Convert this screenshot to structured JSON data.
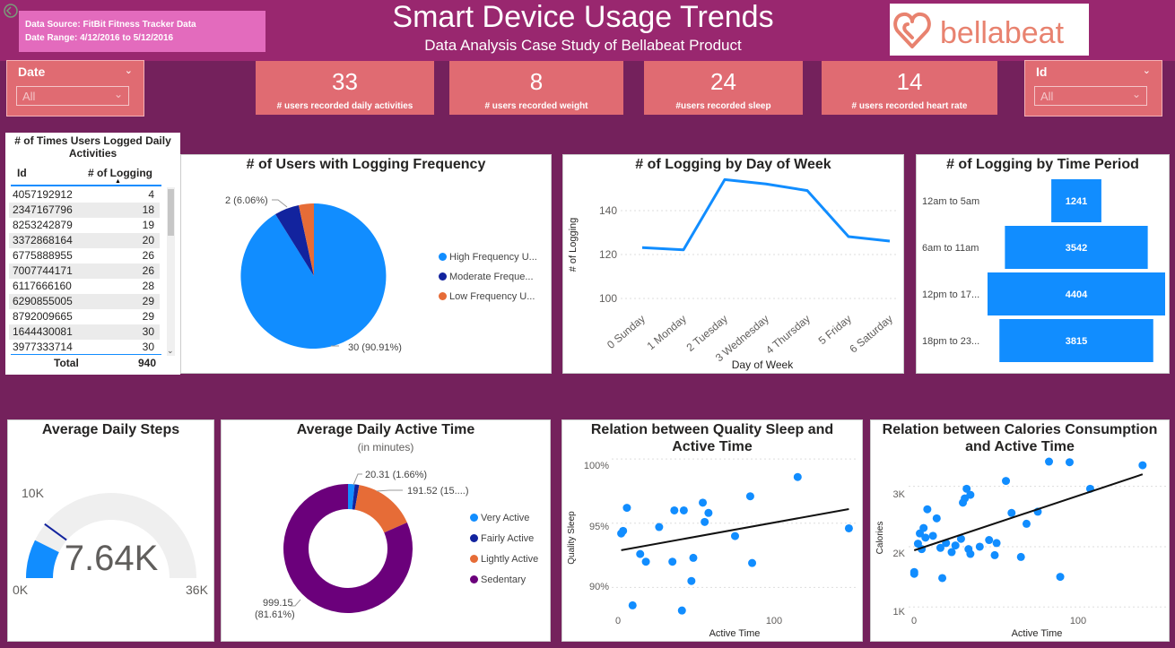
{
  "header": {
    "title": "Smart Device Usage Trends",
    "subtitle": "Data Analysis Case Study of Bellabeat Product",
    "source_line": "Data Source: FitBit Fitness Tracker Data",
    "range_line": "Date Range: 4/12/2016 to 5/12/2016",
    "logo_text": "bellabeat"
  },
  "slicers": {
    "date": {
      "label": "Date",
      "value": "All"
    },
    "id": {
      "label": "Id",
      "value": "All"
    }
  },
  "cards": [
    {
      "value": "33",
      "caption": "# users recorded daily activities"
    },
    {
      "value": "8",
      "caption": "# users recorded weight"
    },
    {
      "value": "24",
      "caption": "#users recorded sleep"
    },
    {
      "value": "14",
      "caption": "# users recorded heart rate"
    }
  ],
  "log_table": {
    "title": "# of Times Users Logged Daily Activities",
    "col_id": "Id",
    "col_count": "# of Logging",
    "rows": [
      {
        "id": "4057192912",
        "n": "4"
      },
      {
        "id": "2347167796",
        "n": "18"
      },
      {
        "id": "8253242879",
        "n": "19"
      },
      {
        "id": "3372868164",
        "n": "20"
      },
      {
        "id": "6775888955",
        "n": "26"
      },
      {
        "id": "7007744171",
        "n": "26"
      },
      {
        "id": "6117666160",
        "n": "28"
      },
      {
        "id": "6290855005",
        "n": "29"
      },
      {
        "id": "8792009665",
        "n": "29"
      },
      {
        "id": "1644430081",
        "n": "30"
      },
      {
        "id": "3977333714",
        "n": "30"
      }
    ],
    "total_label": "Total",
    "total_value": "940"
  },
  "charts": {
    "freq_pie": {
      "title": "# of Users with Logging Frequency",
      "label_small": "2 (6.06%)",
      "label_big": "30 (90.91%)"
    },
    "dow_line": {
      "title": "# of Logging by Day of Week",
      "xlabel": "Day of Week",
      "ylabel": "# of Logging",
      "yticks": [
        "100",
        "120",
        "140"
      ]
    },
    "time_funnel": {
      "title": "# of Logging by Time Period"
    },
    "steps_gauge": {
      "title": "Average Daily Steps",
      "value_label": "7.64K",
      "min_label": "0K",
      "max_label": "36K",
      "target_label": "10K"
    },
    "active_donut": {
      "title": "Average Daily Active Time",
      "subtitle": "(in minutes)",
      "label_very": "20.31 (1.66%)",
      "label_light": "191.52 (15....)",
      "label_sed_1": "999.15",
      "label_sed_2": "(81.61%)"
    },
    "sleep_scatter": {
      "title_1": "Relation between Quality Sleep and",
      "title_2": "Active Time",
      "xlabel": "Active Time",
      "ylabel": "Quality Sleep",
      "yticks": [
        "90%",
        "95%",
        "100%"
      ],
      "xticks": [
        "0",
        "100"
      ]
    },
    "cal_scatter": {
      "title_1": "Relation between Calories Consumption",
      "title_2": "and Active Time",
      "xlabel": "Active Time",
      "ylabel": "Calories",
      "yticks": [
        "1K",
        "2K",
        "3K"
      ],
      "xticks": [
        "0",
        "100"
      ]
    }
  },
  "colors": {
    "background": "#74215c",
    "header": "#99276f",
    "card": "#e06b72",
    "blue": "#118dff",
    "navy": "#12239e",
    "orange": "#e66c37",
    "purple": "#6b007b",
    "source_box": "#e36bbd"
  },
  "chart_data": [
    {
      "type": "pie",
      "title": "# of Users with Logging Frequency",
      "categories": [
        "High Frequency U...",
        "Moderate Freque...",
        "Low Frequency U..."
      ],
      "values": [
        30,
        2,
        1
      ]
    },
    {
      "type": "line",
      "title": "# of Logging by Day of Week",
      "xlabel": "Day of Week",
      "ylabel": "# of Logging",
      "categories": [
        "0 Sunday",
        "1 Monday",
        "2 Tuesday",
        "3 Wednesday",
        "4 Thursday",
        "5 Friday",
        "6 Saturday"
      ],
      "values": [
        121,
        120,
        152,
        150,
        147,
        126,
        124
      ],
      "ylim": [
        95,
        155
      ]
    },
    {
      "type": "bar",
      "title": "# of Logging by Time Period",
      "categories": [
        "12am to 5am",
        "6am to 11am",
        "12pm to 17...",
        "18pm to 23..."
      ],
      "values": [
        1241,
        3542,
        4404,
        3815
      ]
    },
    {
      "type": "pie",
      "title": "Average Daily Active Time",
      "categories": [
        "Very Active",
        "Fairly Active",
        "Lightly Active",
        "Sedentary"
      ],
      "values": [
        20.31,
        13.56,
        191.52,
        999.15
      ]
    },
    {
      "type": "scatter",
      "title": "Relation between Quality Sleep and Active Time",
      "xlabel": "Active Time",
      "ylabel": "Quality Sleep",
      "xlim": [
        -5,
        125
      ],
      "ylim": [
        88,
        100.5
      ],
      "points": [
        [
          0,
          94.2
        ],
        [
          1,
          94.4
        ],
        [
          3,
          96.2
        ],
        [
          6,
          88.6
        ],
        [
          10,
          92.6
        ],
        [
          13,
          92
        ],
        [
          20,
          94.7
        ],
        [
          27,
          92
        ],
        [
          28,
          96
        ],
        [
          33,
          96
        ],
        [
          32,
          88.2
        ],
        [
          37,
          90.5
        ],
        [
          38,
          92.3
        ],
        [
          43,
          96.6
        ],
        [
          44,
          95.1
        ],
        [
          46,
          95.8
        ],
        [
          60,
          94
        ],
        [
          68,
          97.1
        ],
        [
          69,
          91.9
        ],
        [
          93,
          98.6
        ],
        [
          120,
          94.6
        ]
      ],
      "trend": [
        [
          0,
          92.9
        ],
        [
          120,
          96.1
        ]
      ]
    },
    {
      "type": "scatter",
      "title": "Relation between Calories Consumption and Active Time",
      "xlabel": "Active Time",
      "ylabel": "Calories",
      "xlim": [
        -3,
        135
      ],
      "ylim": [
        900,
        3500
      ],
      "points": [
        [
          0,
          1580
        ],
        [
          0,
          1550
        ],
        [
          2,
          2050
        ],
        [
          3,
          2220
        ],
        [
          4,
          1960
        ],
        [
          5,
          2310
        ],
        [
          6,
          2150
        ],
        [
          7,
          2620
        ],
        [
          10,
          2180
        ],
        [
          12,
          2470
        ],
        [
          14,
          1980
        ],
        [
          15,
          1480
        ],
        [
          17,
          2060
        ],
        [
          20,
          1910
        ],
        [
          22,
          2020
        ],
        [
          25,
          2130
        ],
        [
          26,
          2730
        ],
        [
          27,
          2800
        ],
        [
          28,
          2960
        ],
        [
          29,
          1960
        ],
        [
          30,
          1880
        ],
        [
          30,
          2860
        ],
        [
          35,
          2000
        ],
        [
          40,
          2110
        ],
        [
          43,
          1860
        ],
        [
          44,
          2060
        ],
        [
          49,
          3090
        ],
        [
          52,
          2560
        ],
        [
          57,
          1830
        ],
        [
          60,
          2380
        ],
        [
          66,
          2580
        ],
        [
          72,
          3410
        ],
        [
          78,
          1500
        ],
        [
          83,
          3400
        ],
        [
          94,
          2960
        ],
        [
          122,
          3350
        ]
      ],
      "trend": [
        [
          0,
          1940
        ],
        [
          122,
          3200
        ]
      ]
    }
  ]
}
